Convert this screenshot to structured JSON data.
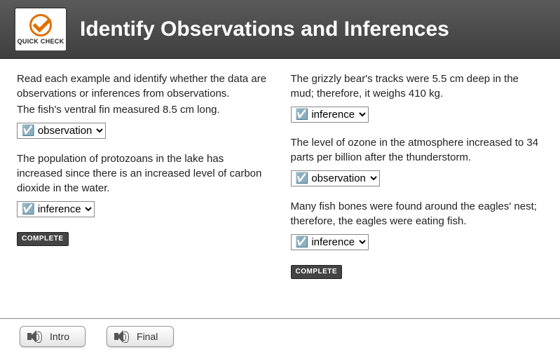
{
  "header": {
    "logo_text": "QUICK CHECK",
    "title": "Identify Observations and Inferences"
  },
  "left": {
    "intro": "Read each example and identify whether the data are observations or  inferences from observations.",
    "q1": {
      "text": "The fish's ventral fin measured 8.5 cm long.",
      "selected": "☑️ observation"
    },
    "q2": {
      "text": "The population of  protozoans in the lake has increased since there is an increased level of carbon dioxide in the water.",
      "selected": "☑️ inference"
    },
    "complete": "COMPLETE"
  },
  "right": {
    "q1": {
      "text": "The grizzly bear's tracks were 5.5 cm deep in the mud; therefore, it weighs 410 kg.",
      "selected": "☑️ inference"
    },
    "q2": {
      "text": "The level of ozone in the atmosphere increased to 34 parts per billion after the thunderstorm.",
      "selected": "☑️ observation"
    },
    "q3": {
      "text": "Many fish bones were found around the eagles' nest; therefore, the eagles were eating fish.",
      "selected": "☑️ inference"
    },
    "complete": "COMPLETE"
  },
  "footer": {
    "intro": "Intro",
    "final": "Final"
  }
}
